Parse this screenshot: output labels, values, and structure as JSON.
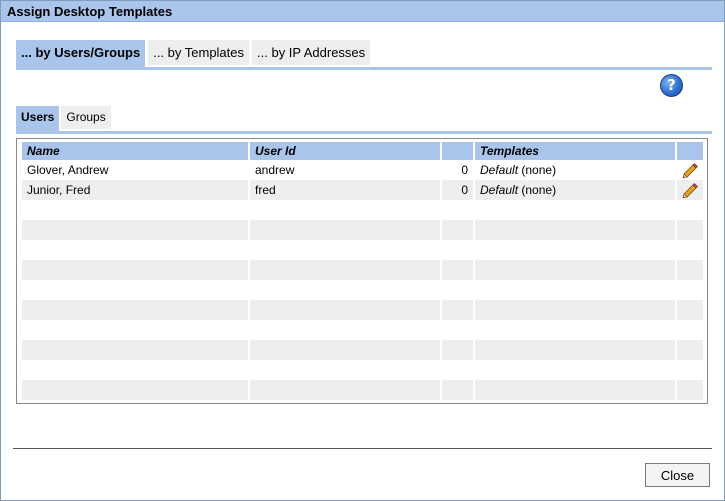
{
  "window": {
    "title": "Assign Desktop Templates"
  },
  "top_tabs": [
    {
      "label": "... by Users/Groups",
      "active": true
    },
    {
      "label": "... by Templates",
      "active": false
    },
    {
      "label": "... by IP Addresses",
      "active": false
    }
  ],
  "help": {
    "icon": "help-icon",
    "glyph": "?"
  },
  "sub_tabs": [
    {
      "label": "Users",
      "active": true
    },
    {
      "label": "Groups",
      "active": false
    }
  ],
  "table": {
    "columns": [
      "Name",
      "User Id",
      "",
      "Templates",
      ""
    ],
    "rows": [
      {
        "name": "Glover, Andrew",
        "user_id": "andrew",
        "count": "0",
        "template_default": "Default",
        "template_extra": "(none)",
        "action_icon": "pencil-icon"
      },
      {
        "name": "Junior, Fred",
        "user_id": "fred",
        "count": "0",
        "template_default": "Default",
        "template_extra": "(none)",
        "action_icon": "pencil-icon"
      }
    ]
  },
  "footer": {
    "close_label": "Close"
  }
}
